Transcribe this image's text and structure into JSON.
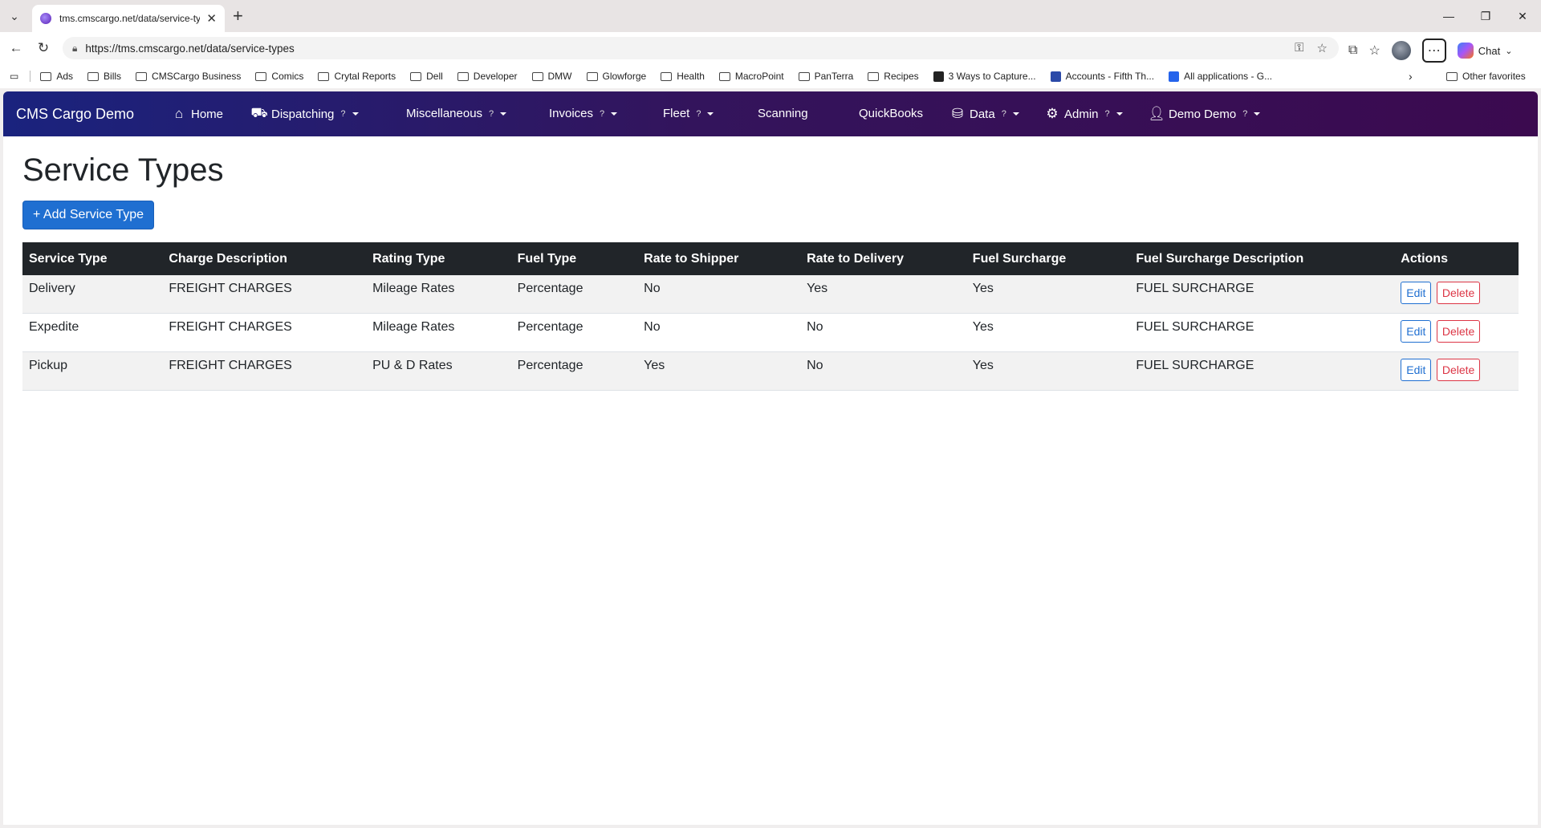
{
  "browser": {
    "tab_title": "tms.cmscargo.net/data/service-types",
    "url": "https://tms.cmscargo.net/data/service-types",
    "chat_label": "Chat",
    "bookmarks": [
      {
        "label": "Ads",
        "icon": "folder-icon"
      },
      {
        "label": "Bills",
        "icon": "folder-icon"
      },
      {
        "label": "CMSCargo Business",
        "icon": "folder-icon"
      },
      {
        "label": "Comics",
        "icon": "folder-icon"
      },
      {
        "label": "Crytal Reports",
        "icon": "folder-icon"
      },
      {
        "label": "Dell",
        "icon": "folder-icon"
      },
      {
        "label": "Developer",
        "icon": "folder-icon"
      },
      {
        "label": "DMW",
        "icon": "folder-icon"
      },
      {
        "label": "Glowforge",
        "icon": "folder-icon"
      },
      {
        "label": "Health",
        "icon": "folder-icon"
      },
      {
        "label": "MacroPoint",
        "icon": "folder-icon"
      },
      {
        "label": "PanTerra",
        "icon": "folder-icon"
      },
      {
        "label": "Recipes",
        "icon": "folder-icon"
      },
      {
        "label": "3 Ways to Capture...",
        "icon": "site-icon"
      },
      {
        "label": "Accounts - Fifth Th...",
        "icon": "site-icon"
      },
      {
        "label": "All applications - G...",
        "icon": "site-icon"
      }
    ],
    "other_favorites": "Other favorites"
  },
  "app": {
    "brand": "CMS Cargo Demo",
    "nav": [
      {
        "label": "Home",
        "icon": "home-icon",
        "help": "",
        "dropdown": false
      },
      {
        "label": "Dispatching",
        "icon": "truck-icon",
        "help": "?",
        "dropdown": true
      },
      {
        "label": "Miscellaneous",
        "icon": "",
        "help": "?",
        "dropdown": true
      },
      {
        "label": "Invoices",
        "icon": "",
        "help": "?",
        "dropdown": true
      },
      {
        "label": "Fleet",
        "icon": "",
        "help": "?",
        "dropdown": true
      },
      {
        "label": "Scanning",
        "icon": "",
        "help": "",
        "dropdown": false
      },
      {
        "label": "QuickBooks",
        "icon": "",
        "help": "",
        "dropdown": false
      },
      {
        "label": "Data",
        "icon": "database-icon",
        "help": "?",
        "dropdown": true
      },
      {
        "label": "Admin",
        "icon": "gear-icon",
        "help": "?",
        "dropdown": true
      },
      {
        "label": "Demo Demo",
        "icon": "user-icon",
        "help": "?",
        "dropdown": true
      }
    ]
  },
  "page": {
    "title": "Service Types",
    "add_button": "+ Add Service Type",
    "columns": [
      "Service Type",
      "Charge Description",
      "Rating Type",
      "Fuel Type",
      "Rate to Shipper",
      "Rate to Delivery",
      "Fuel Surcharge",
      "Fuel Surcharge Description",
      "Actions"
    ],
    "rows": [
      [
        "Delivery",
        "FREIGHT CHARGES",
        "Mileage Rates",
        "Percentage",
        "No",
        "Yes",
        "Yes",
        "FUEL SURCHARGE"
      ],
      [
        "Expedite",
        "FREIGHT CHARGES",
        "Mileage Rates",
        "Percentage",
        "No",
        "No",
        "Yes",
        "FUEL SURCHARGE"
      ],
      [
        "Pickup",
        "FREIGHT CHARGES",
        "PU & D Rates",
        "Percentage",
        "Yes",
        "No",
        "Yes",
        "FUEL SURCHARGE"
      ]
    ],
    "edit_label": "Edit",
    "delete_label": "Delete"
  }
}
